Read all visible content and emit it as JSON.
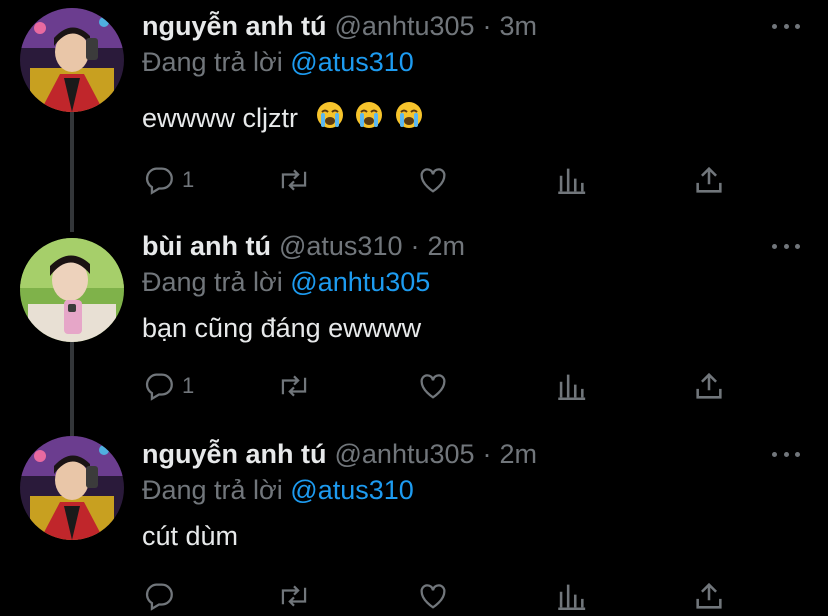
{
  "tweets": [
    {
      "name": "nguyễn anh tú",
      "handle": "@anhtu305",
      "separator": "·",
      "time": "3m",
      "replying_prefix": "Đang trả lời",
      "replying_to": "@atus310",
      "text": "ewwww cljztr",
      "emojis": [
        "loudly-crying-face",
        "loudly-crying-face",
        "loudly-crying-face"
      ],
      "reply_count": "1"
    },
    {
      "name": "bùi anh tú",
      "handle": "@atus310",
      "separator": "·",
      "time": "2m",
      "replying_prefix": "Đang trả lời",
      "replying_to": "@anhtu305",
      "text": "bạn cũng đáng ewwww",
      "reply_count": "1"
    },
    {
      "name": "nguyễn anh tú",
      "handle": "@anhtu305",
      "separator": "·",
      "time": "2m",
      "replying_prefix": "Đang trả lời",
      "replying_to": "@atus310",
      "text": "cút dùm",
      "reply_count": ""
    }
  ],
  "colors": {
    "background": "#000000",
    "primary_text": "#e7e9ea",
    "secondary_text": "#71767b",
    "accent": "#1d9bf0",
    "thread_line": "#333639"
  },
  "icons": [
    "reply-icon",
    "retweet-icon",
    "like-icon",
    "stats-icon",
    "share-icon",
    "more-icon"
  ]
}
